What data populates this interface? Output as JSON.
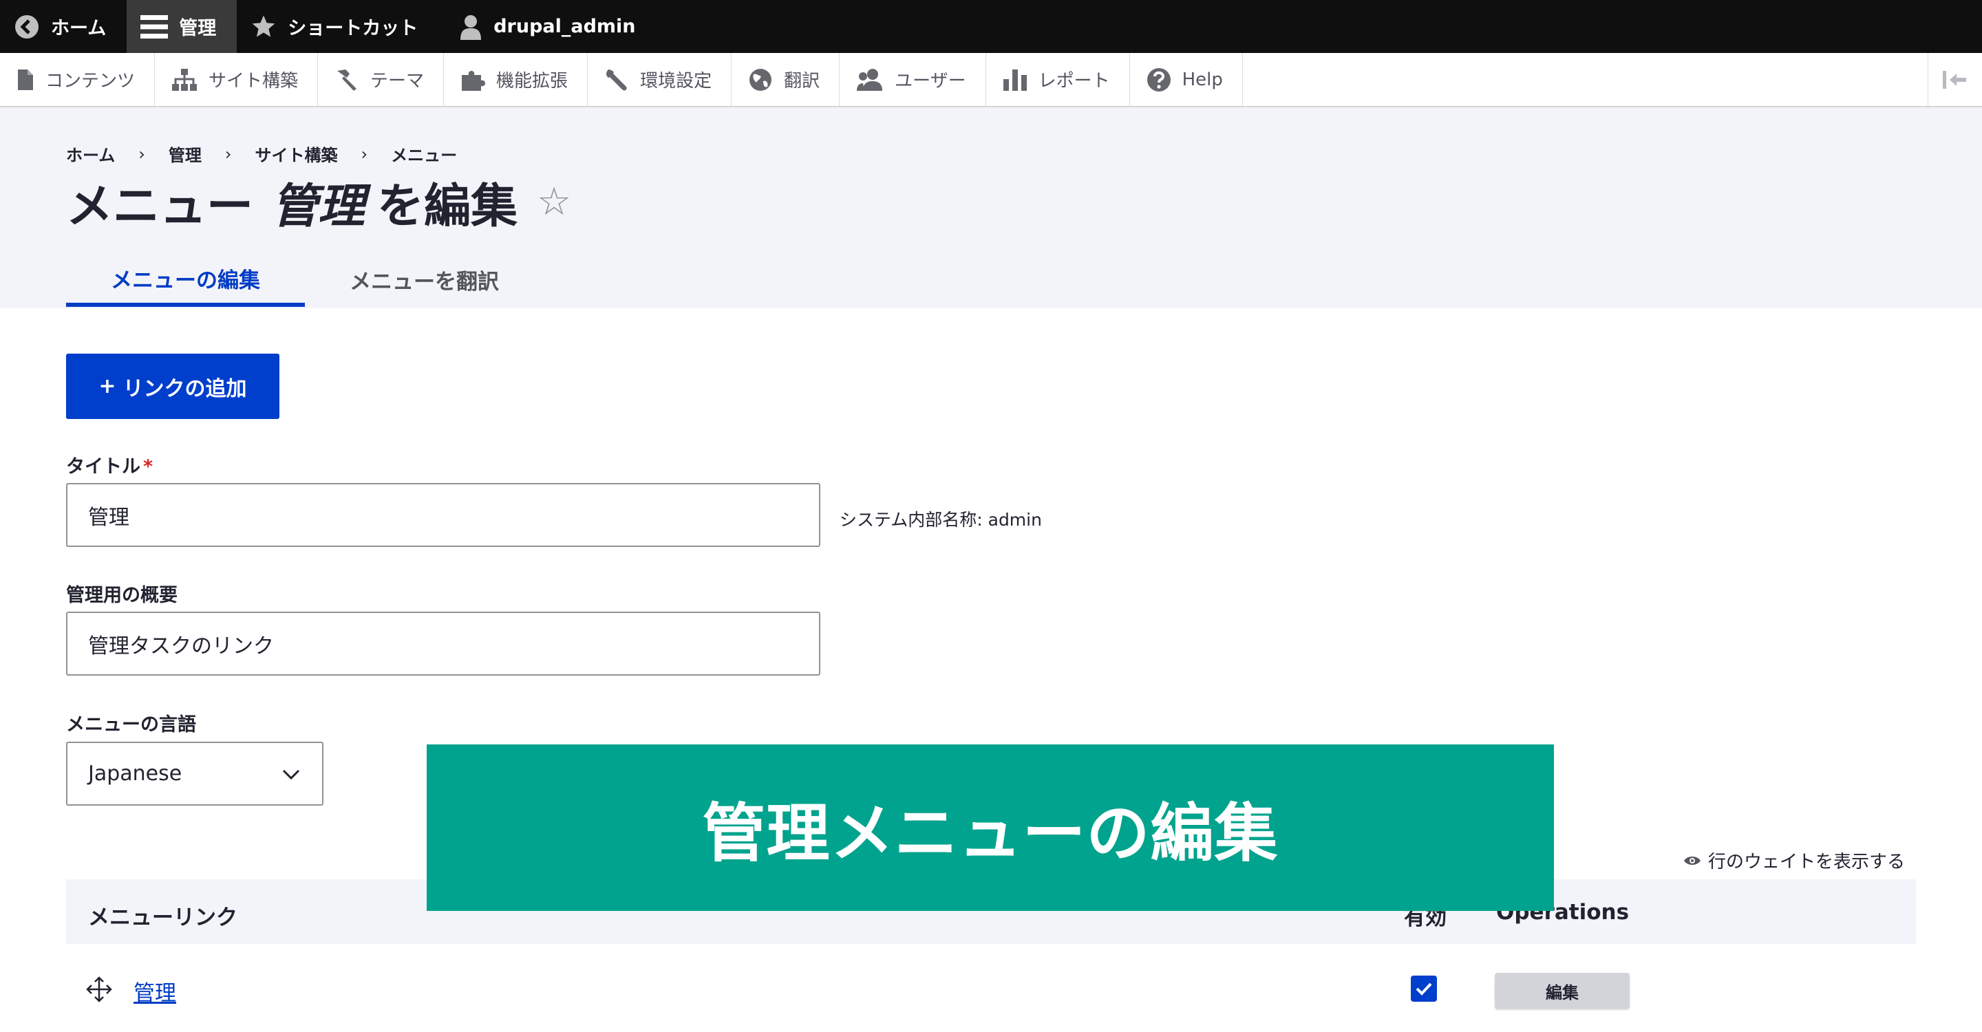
{
  "toolbar": {
    "back_home": "ホーム",
    "manage": "管理",
    "shortcuts": "ショートカット",
    "user": "drupal_admin"
  },
  "tray": {
    "items": [
      {
        "label": "コンテンツ",
        "icon": "file-icon"
      },
      {
        "label": "サイト構築",
        "icon": "sitemap-icon"
      },
      {
        "label": "テーマ",
        "icon": "paint-brush-icon"
      },
      {
        "label": "機能拡張",
        "icon": "puzzle-icon"
      },
      {
        "label": "環境設定",
        "icon": "wrench-icon"
      },
      {
        "label": "翻訳",
        "icon": "globe-icon"
      },
      {
        "label": "ユーザー",
        "icon": "users-icon"
      },
      {
        "label": "レポート",
        "icon": "bar-chart-icon"
      },
      {
        "label": "Help",
        "icon": "help-icon"
      }
    ]
  },
  "breadcrumb": [
    "ホーム",
    "管理",
    "サイト構築",
    "メニュー"
  ],
  "breadcrumb_sep": "›",
  "page": {
    "title_prefix": "メニュー",
    "title_name": "管理",
    "title_suffix": "を編集",
    "star": "☆"
  },
  "tabs": [
    {
      "label": "メニューの編集",
      "active": true
    },
    {
      "label": "メニューを翻訳",
      "active": false
    }
  ],
  "actions": {
    "add_link_plus": "+",
    "add_link": "リンクの追加"
  },
  "form": {
    "title_label": "タイトル",
    "required_mark": "*",
    "title_value": "管理",
    "machine_name": "システム内部名称: admin",
    "description_label": "管理用の概要",
    "description_value": "管理タスクのリンク",
    "language_label": "メニューの言語",
    "language_value": "Japanese"
  },
  "table": {
    "show_weights": "行のウェイトを表示する",
    "headers": {
      "link": "メニューリンク",
      "enabled": "有効",
      "operations": "Operations"
    },
    "rows": [
      {
        "title": "管理",
        "enabled": true,
        "operation": "編集"
      }
    ]
  },
  "banner": {
    "text": "管理メニューの編集"
  },
  "colors": {
    "accent": "#003ecc",
    "banner": "#00a38d",
    "topbar": "#0f0f0f"
  }
}
